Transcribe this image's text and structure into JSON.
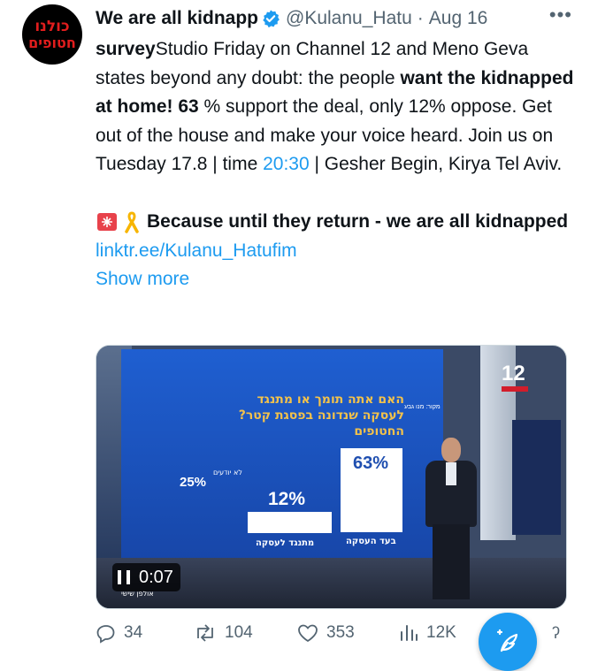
{
  "avatar": {
    "line1": "כולנו",
    "line2": "חטופים"
  },
  "header": {
    "name": "We are all kidnapp",
    "handle": "@Kulanu_Hatu",
    "separator": "·",
    "date": "Aug 16",
    "more": "•••"
  },
  "tweet": {
    "p1_bold_a": "survey",
    "p1_text_a": "Studio Friday on Channel 12 and Meno Geva states beyond any doubt: the people ",
    "p1_bold_b": "want the kidnapped at home! 63",
    "p1_text_b": " % support the deal, only 12% oppose. Get out of the house and make your voice heard. Join us on Tuesday 17.8 | time ",
    "p1_time": "20:30",
    "p1_text_c": " | Gesher Begin, Kirya Tel Aviv.",
    "p2_bold": "Because until they return - we are all kidnapped",
    "p2_link": "linktr.ee/Kulanu_Hatufim",
    "show_more": "Show more"
  },
  "media": {
    "question": "האם אתה תומך או מתנגד לעסקה שנדונה בפסגת קטר? החטופים",
    "source": "מקור: מנו גבע",
    "support_pct": "63%",
    "support_label": "בעד העסקה",
    "oppose_pct": "12%",
    "oppose_label": "מתנגד לעסקה",
    "unknown_pct": "25%",
    "unknown_label": "לא יודעים",
    "channel_logo": "12",
    "ticker": "אולפן שישי",
    "time": "0:07",
    "values": {
      "support": 63,
      "oppose": 12,
      "unknown": 25
    }
  },
  "actions": {
    "replies": "34",
    "retweets": "104",
    "likes": "353",
    "views": "12K"
  },
  "colors": {
    "accent": "#1d9bf0",
    "text": "#0f1419",
    "muted": "#536471",
    "avatar_red": "#e11d1d"
  }
}
